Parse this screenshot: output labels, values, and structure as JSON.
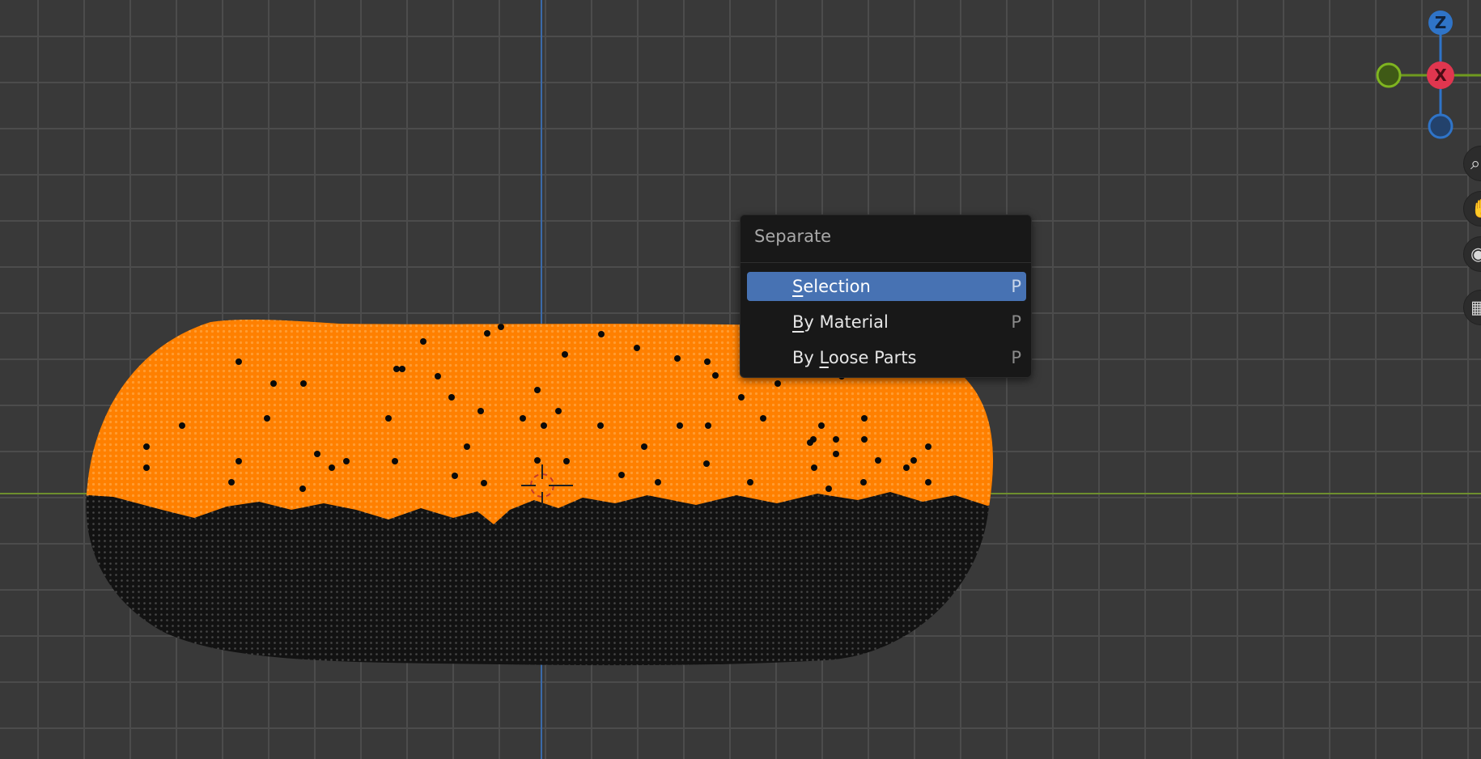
{
  "viewport": {
    "background": "#393939",
    "grid_color": "#4c4c4c",
    "x_axis_color": "#6e8f2e",
    "y_axis_color": "#3b6aa9",
    "mesh_selected_color": "#ff8000",
    "mesh_unselected_color": "#111111"
  },
  "gizmo": {
    "z_label": "Z",
    "x_label": "X",
    "z_color": "#2f74c8",
    "x_color": "#e0364f",
    "y_color": "#6f9a1f"
  },
  "nav_tools": [
    "zoom-icon",
    "pan-hand-icon",
    "camera-icon",
    "grid-view-icon"
  ],
  "menu": {
    "title": "Separate",
    "items": [
      {
        "first": "S",
        "rest": "election",
        "shortcut": "P",
        "active": true
      },
      {
        "first": "B",
        "rest": "y Material",
        "shortcut": "P",
        "active": false
      },
      {
        "pre": "By ",
        "first": "L",
        "rest": "oose Parts",
        "shortcut": "P",
        "active": false
      }
    ]
  }
}
